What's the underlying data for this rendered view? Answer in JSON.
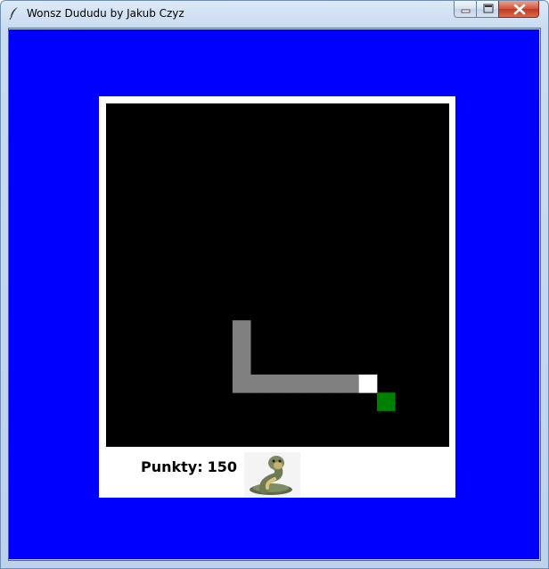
{
  "window": {
    "title": "Wonsz Dududu by Jakub Czyz",
    "icon": "feather-icon"
  },
  "colors": {
    "background": "#0000ff",
    "panel": "#ffffff",
    "board": "#000000",
    "snake_body": "#808080",
    "snake_head": "#ffffff",
    "food": "#008000"
  },
  "game": {
    "grid_cells": 19,
    "snake": [
      [
        7,
        12
      ],
      [
        7,
        13
      ],
      [
        7,
        15
      ],
      [
        8,
        15
      ],
      [
        9,
        15
      ],
      [
        10,
        15
      ],
      [
        11,
        15
      ],
      [
        12,
        15
      ],
      [
        13,
        15
      ],
      [
        14,
        15
      ]
    ],
    "head": [
      14,
      15
    ],
    "food": [
      15,
      16
    ]
  },
  "score": {
    "label": "Punkty:",
    "value": "150"
  },
  "mascot": {
    "icon": "cobra-icon"
  }
}
